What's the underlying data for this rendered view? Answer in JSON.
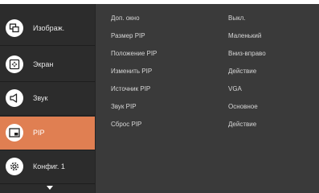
{
  "sidebar": {
    "items": [
      {
        "label": "Изображ.",
        "icon": "picture-icon"
      },
      {
        "label": "Экран",
        "icon": "screen-icon"
      },
      {
        "label": "Звук",
        "icon": "speaker-icon"
      },
      {
        "label": "PIP",
        "icon": "pip-icon",
        "active": true
      },
      {
        "label": "Конфиг. 1",
        "icon": "gear-icon"
      }
    ]
  },
  "pip_menu": {
    "rows": [
      {
        "label": "Доп. окно",
        "value": "Выкл."
      },
      {
        "label": "Размер PIP",
        "value": "Маленький"
      },
      {
        "label": "Положение PIP",
        "value": "Вниз-вправо"
      },
      {
        "label": "Изменить PIP",
        "value": "Действие"
      },
      {
        "label": "Источник PIP",
        "value": "VGA"
      },
      {
        "label": "Звук PIP",
        "value": "Основное"
      },
      {
        "label": "Сброс PIP",
        "value": "Действие"
      }
    ]
  },
  "colors": {
    "panel": "#3a3a3a",
    "sidebar": "#2c2c2c",
    "accent": "#e07f52",
    "text": "#d6d6d6"
  }
}
